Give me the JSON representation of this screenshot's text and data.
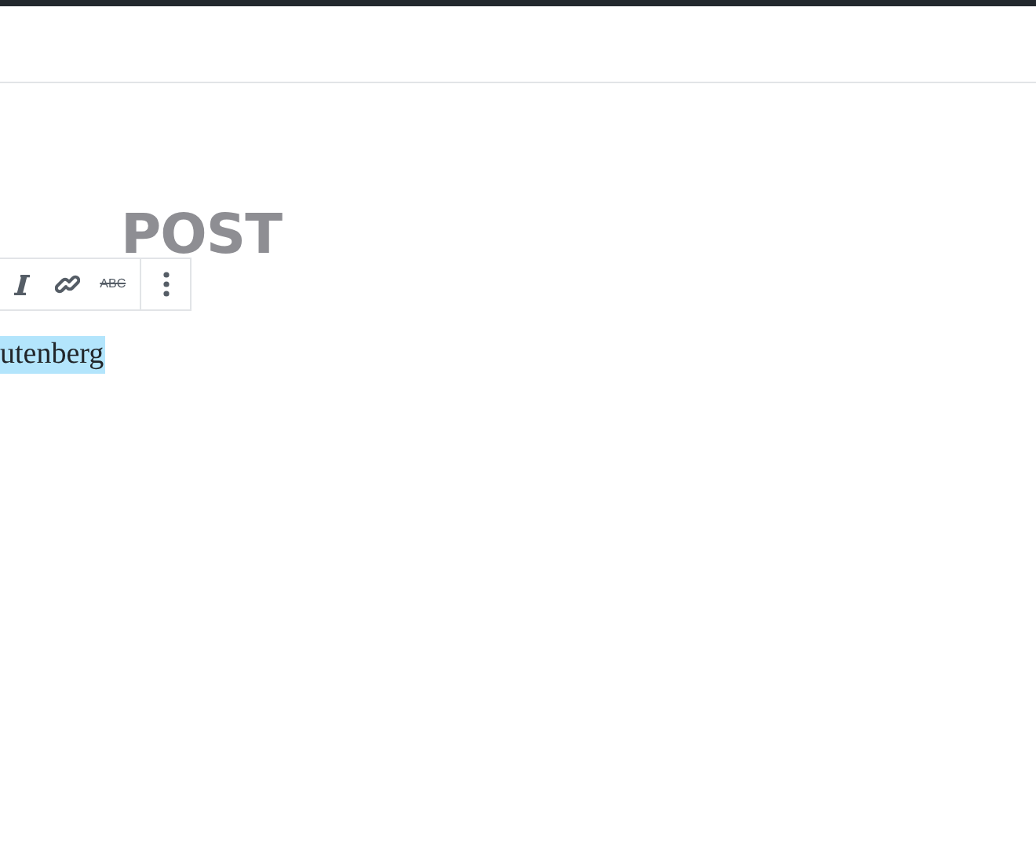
{
  "post_title": "POST",
  "toolbar": {
    "buttons": [
      {
        "kind": "italic"
      },
      {
        "kind": "link"
      },
      {
        "kind": "strikethrough",
        "label": "ABC"
      },
      {
        "kind": "more"
      }
    ]
  },
  "paragraph": {
    "text": "utenberg",
    "selected": true
  }
}
